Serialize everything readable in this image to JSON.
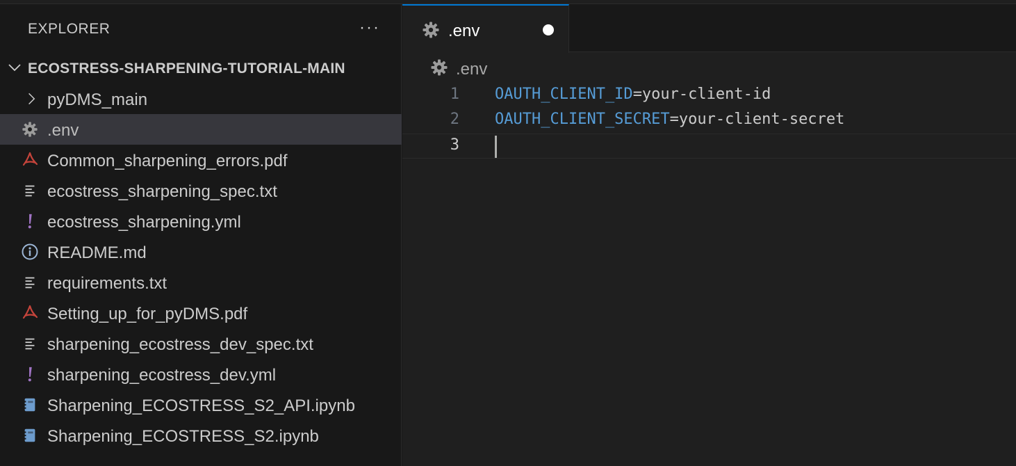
{
  "explorer": {
    "title": "EXPLORER",
    "more_label": "···",
    "root_label": "ECOSTRESS-SHARPENING-TUTORIAL-MAIN"
  },
  "tree": [
    {
      "label": "pyDMS_main",
      "icon": "chevron-right-icon",
      "selected": false
    },
    {
      "label": ".env",
      "icon": "gear-icon",
      "selected": true
    },
    {
      "label": "Common_sharpening_errors.pdf",
      "icon": "pdf-icon",
      "selected": false
    },
    {
      "label": "ecostress_sharpening_spec.txt",
      "icon": "text-file-icon",
      "selected": false
    },
    {
      "label": "ecostress_sharpening.yml",
      "icon": "yaml-icon",
      "selected": false
    },
    {
      "label": "README.md",
      "icon": "info-icon",
      "selected": false
    },
    {
      "label": "requirements.txt",
      "icon": "text-file-icon",
      "selected": false
    },
    {
      "label": "Setting_up_for_pyDMS.pdf",
      "icon": "pdf-icon",
      "selected": false
    },
    {
      "label": "sharpening_ecostress_dev_spec.txt",
      "icon": "text-file-icon",
      "selected": false
    },
    {
      "label": "sharpening_ecostress_dev.yml",
      "icon": "yaml-icon",
      "selected": false
    },
    {
      "label": "Sharpening_ECOSTRESS_S2_API.ipynb",
      "icon": "notebook-icon",
      "selected": false
    },
    {
      "label": "Sharpening_ECOSTRESS_S2.ipynb",
      "icon": "notebook-icon",
      "selected": false
    }
  ],
  "tab": {
    "label": ".env",
    "icon": "gear-icon"
  },
  "breadcrumb": {
    "label": ".env",
    "icon": "gear-icon"
  },
  "code": {
    "lines": [
      {
        "num": "1",
        "key": "OAUTH_CLIENT_ID",
        "rest": "=your-client-id"
      },
      {
        "num": "2",
        "key": "OAUTH_CLIENT_SECRET",
        "rest": "=your-client-secret"
      },
      {
        "num": "3",
        "key": "",
        "rest": ""
      }
    ]
  },
  "colors": {
    "accent": "#0078d4",
    "key": "#569cd6",
    "pdf": "#c5443b",
    "yaml": "#a074c4",
    "info": "#9cb6d6",
    "notebook": "#6d9ccd",
    "gear": "#9b9b9b"
  }
}
